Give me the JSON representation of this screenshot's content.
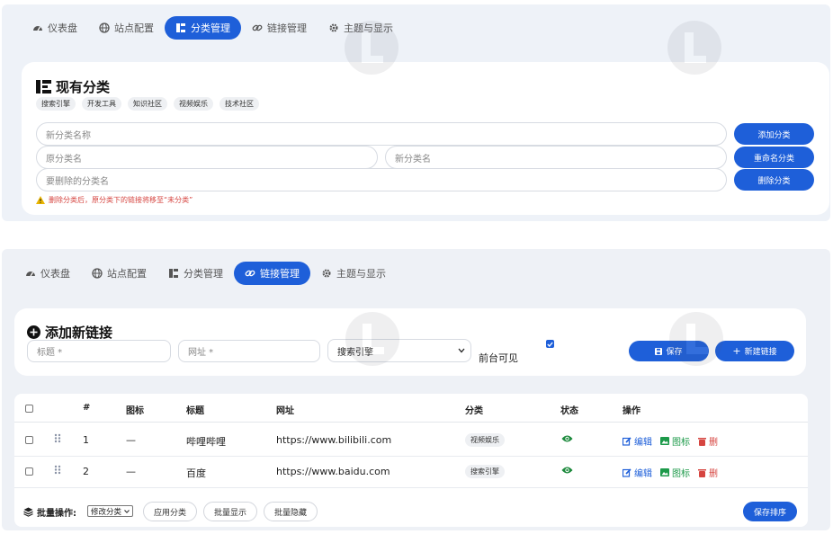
{
  "colors": {
    "accent": "#1e5fd9",
    "danger": "#d64540",
    "success": "#1d8a3d",
    "edit": "#1e5fd9",
    "icon_op": "#1d9a4a",
    "delete": "#d64540"
  },
  "top": {
    "tabs": [
      {
        "label": "仪表盘",
        "icon": "dashboard-icon"
      },
      {
        "label": "站点配置",
        "icon": "globe-icon"
      },
      {
        "label": "分类管理",
        "icon": "sitemap-icon",
        "active": true
      },
      {
        "label": "链接管理",
        "icon": "link-icon"
      },
      {
        "label": "主题与显示",
        "icon": "gear-icon"
      }
    ],
    "section_title": "现有分类",
    "categories": [
      "搜索引擎",
      "开发工具",
      "知识社区",
      "视频娱乐",
      "技术社区"
    ],
    "new_category_placeholder": "新分类名称",
    "add_button": "添加分类",
    "old_name_placeholder": "原分类名",
    "new_name_placeholder": "新分类名",
    "rename_button": "重命名分类",
    "delete_placeholder": "要删除的分类名",
    "delete_button": "删除分类",
    "warning": "删除分类后，原分类下的链接将移至“未分类”"
  },
  "bottom": {
    "tabs": [
      {
        "label": "仪表盘",
        "icon": "dashboard-icon"
      },
      {
        "label": "站点配置",
        "icon": "globe-icon"
      },
      {
        "label": "分类管理",
        "icon": "sitemap-icon"
      },
      {
        "label": "链接管理",
        "icon": "link-icon",
        "active": true
      },
      {
        "label": "主题与显示",
        "icon": "gear-icon"
      }
    ],
    "add_title": "添加新链接",
    "title_placeholder": "标题 *",
    "url_placeholder": "网址 *",
    "category_select": "搜索引擎",
    "visible_label": "前台可见",
    "visible_checked": true,
    "save_button": "保存",
    "new_button": "新建链接",
    "table": {
      "headers": [
        "#",
        "图标",
        "标题",
        "网址",
        "分类",
        "状态",
        "操作"
      ],
      "rows": [
        {
          "num": "1",
          "icon": "—",
          "title": "哔哩哔哩",
          "url": "https://www.bilibili.com",
          "category": "视频娱乐"
        },
        {
          "num": "2",
          "icon": "—",
          "title": "百度",
          "url": "https://www.baidu.com",
          "category": "搜索引擎"
        }
      ],
      "ops": {
        "edit": "编辑",
        "icon": "图标",
        "delete": "删"
      }
    },
    "batch": {
      "label": "批量操作:",
      "select": "修改分类",
      "apply": "应用分类",
      "show": "批量显示",
      "hide": "批量隐藏",
      "save_order": "保存排序"
    }
  }
}
